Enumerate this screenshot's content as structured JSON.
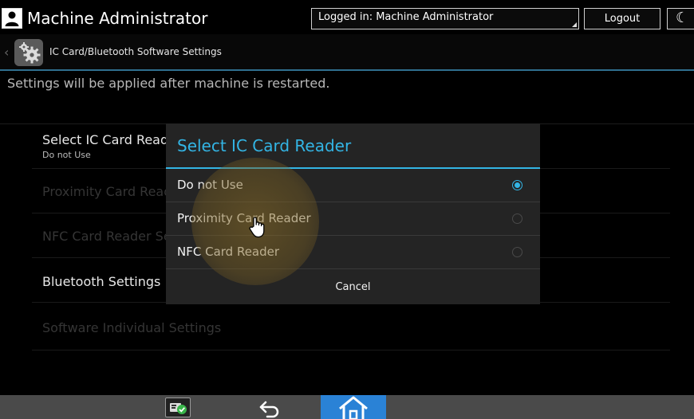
{
  "header": {
    "title": "Machine Administrator",
    "logged_in": "Logged in: Machine Administrator",
    "logout_label": "Logout"
  },
  "breadcrumb": {
    "title": "IC Card/Bluetooth Software Settings"
  },
  "notice": "Settings will be applied after machine is restarted.",
  "settings": {
    "items": [
      {
        "label": "Select IC Card Reader",
        "value": "Do not Use",
        "enabled": true
      },
      {
        "label": "Proximity Card Reader",
        "enabled": false
      },
      {
        "label": "NFC Card Reader Settings",
        "enabled": false
      },
      {
        "label": "Bluetooth Settings",
        "enabled": true
      },
      {
        "label": "Software Individual Settings",
        "enabled": false
      }
    ]
  },
  "dialog": {
    "title": "Select IC Card Reader",
    "options": [
      {
        "label": "Do not Use",
        "selected": true
      },
      {
        "label": "Proximity Card Reader",
        "selected": false
      },
      {
        "label": "NFC Card Reader",
        "selected": false
      }
    ],
    "cancel_label": "Cancel"
  },
  "icons": {
    "user": "user-icon",
    "sleep": "moon-icon",
    "settings": "gear-icon",
    "status": "status-check-icon",
    "back": "back-arrow-icon",
    "home": "home-icon"
  },
  "colors": {
    "accent": "#33b5e5",
    "home_button": "#2a82d6",
    "dialog_bg": "#242424",
    "nav_bar": "#4a4a4a"
  }
}
